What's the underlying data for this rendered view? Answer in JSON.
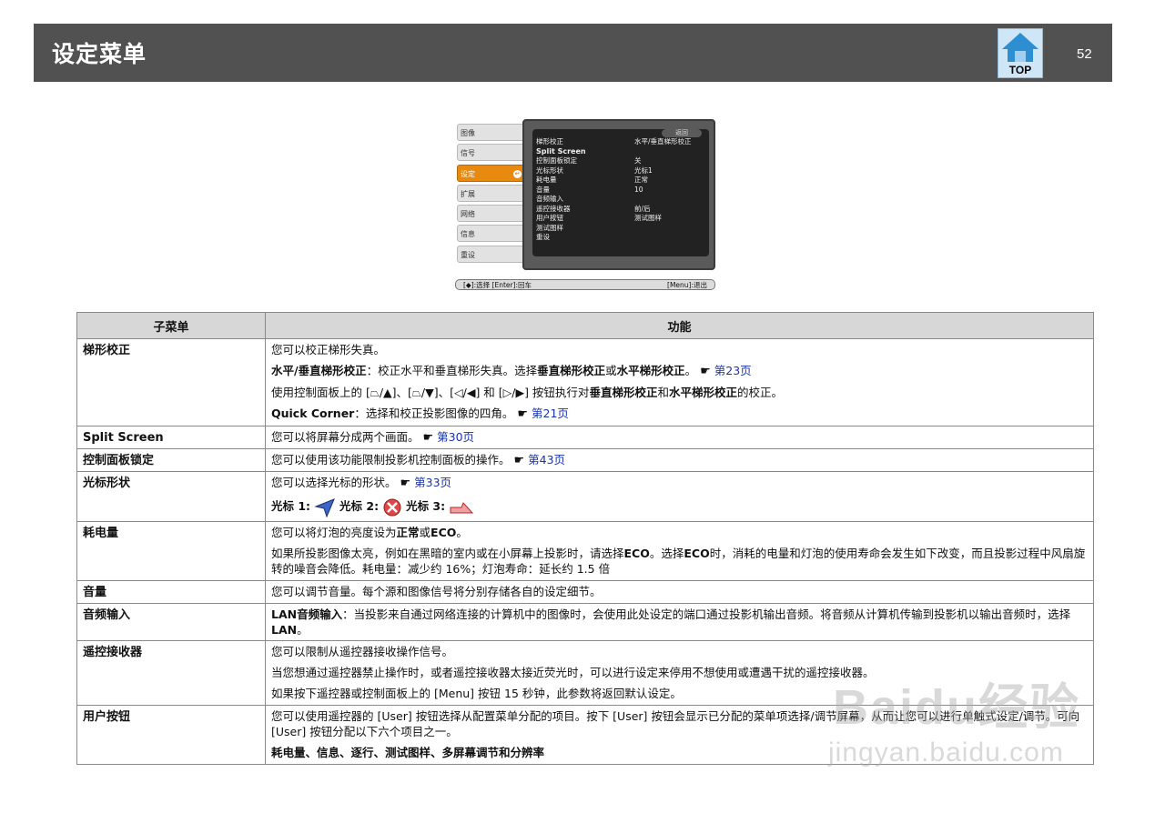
{
  "header": {
    "title": "设定菜单",
    "top_label": "TOP",
    "page_number": "52"
  },
  "osd": {
    "tabs": [
      "图像",
      "信号",
      "设定",
      "扩展",
      "网络",
      "信息",
      "重设"
    ],
    "active_tab": "设定",
    "back": "返回",
    "rows": [
      {
        "label": "梯形校正",
        "value": "水平/垂直梯形校正"
      },
      {
        "label": "Split Screen",
        "value": ""
      },
      {
        "label": "控制面板锁定",
        "value": "关"
      },
      {
        "label": "光标形状",
        "value": "光标1"
      },
      {
        "label": "耗电量",
        "value": "正常"
      },
      {
        "label": "音量",
        "value": "10"
      },
      {
        "label": "音频输入",
        "value": ""
      },
      {
        "label": "遥控接收器",
        "value": "前/后"
      },
      {
        "label": "用户按钮",
        "value": "测试图样"
      },
      {
        "label": "测试图样",
        "value": ""
      },
      {
        "label": "重设",
        "value": ""
      }
    ],
    "help_left": "[◆]:选择 [Enter]:回车",
    "help_right": "[Menu]:退出"
  },
  "table": {
    "col_headers": [
      "子菜单",
      "功能"
    ],
    "rows": {
      "keystone": {
        "name": "梯形校正",
        "l1": "您可以校正梯形失真。",
        "l2a": "水平/垂直梯形校正",
        "l2b": "：校正水平和垂直梯形失真。选择",
        "l2c": "垂直梯形校正",
        "l2d": "或",
        "l2e": "水平梯形校正",
        "l2f": "。",
        "l2link": "第23页",
        "l3a": "使用控制面板上的 [⏢/▲]、[⏢/▼]、[◁/◀] 和 [▷/▶] 按钮执行对",
        "l3b": "垂直梯形校正",
        "l3c": "和",
        "l3d": "水平梯形校正",
        "l3e": "的校正。",
        "l4a": "Quick Corner",
        "l4b": "：选择和校正投影图像的四角。",
        "l4link": "第21页"
      },
      "split": {
        "name": "Split Screen",
        "text": "您可以将屏幕分成两个画面。",
        "link": "第30页"
      },
      "panel_lock": {
        "name": "控制面板锁定",
        "text": "您可以使用该功能限制投影机控制面板的操作。",
        "link": "第43页"
      },
      "cursor": {
        "name": "光标形状",
        "text": "您可以选择光标的形状。",
        "link": "第33页",
        "c1": "光标 1:",
        "c2": "光标 2:",
        "c3": "光标 3:"
      },
      "power": {
        "name": "耗电量",
        "l1a": "您可以将灯泡的亮度设为",
        "l1b": "正常",
        "l1c": "或",
        "l1d": "ECO",
        "l1e": "。",
        "l2a": "如果所投影图像太亮，例如在黑暗的室内或在小屏幕上投影时，请选择",
        "l2b": "ECO",
        "l2c": "。选择",
        "l2d": "ECO",
        "l2e": "时，消耗的电量和灯泡的使用寿命会发生如下改变，而且投影过程中风扇旋转的噪音会降低。耗电量：减少约 16%；灯泡寿命：延长约 1.5 倍"
      },
      "volume": {
        "name": "音量",
        "text": "您可以调节音量。每个源和图像信号将分别存储各自的设定细节。"
      },
      "audio": {
        "name": "音频输入",
        "a": "LAN音频输入",
        "b": "：当投影来自通过网络连接的计算机中的图像时，会使用此处设定的端口通过投影机输出音频。将音频从计算机传输到投影机以输出音频时，选择",
        "c": "LAN",
        "d": "。"
      },
      "remote": {
        "name": "遥控接收器",
        "l1": "您可以限制从遥控器接收操作信号。",
        "l2": "当您想通过遥控器禁止操作时，或者遥控接收器太接近荧光时，可以进行设定来停用不想使用或遭遇干扰的遥控接收器。",
        "l3": "如果按下遥控器或控制面板上的 [Menu] 按钮 15 秒钟，此参数将返回默认设定。"
      },
      "user": {
        "name": "用户按钮",
        "l1": "您可以使用遥控器的 [User] 按钮选择从配置菜单分配的项目。按下 [User] 按钮会显示已分配的菜单项选择/调节屏幕，从而让您可以进行单触式设定/调节。可向 [User] 按钮分配以下六个项目之一。",
        "l2": "耗电量、信息、逐行、测试图样、多屏幕调节和分辨率"
      }
    }
  },
  "watermark": {
    "line1": "Baidu经验",
    "line2": "jingyan.baidu.com"
  },
  "colors": {
    "header_bg": "#515151",
    "osd_active": "#e88a10",
    "link": "#1a33a8",
    "table_head": "#d7d7d7"
  }
}
